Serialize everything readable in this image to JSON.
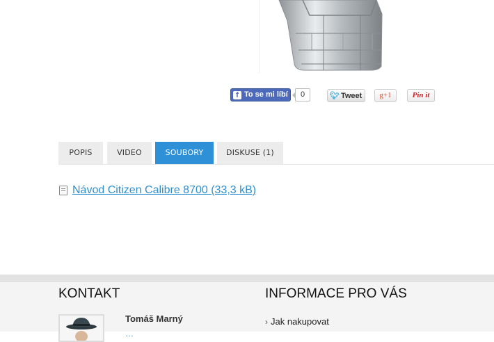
{
  "product": {
    "image_alt": "watch-bracelet"
  },
  "social": {
    "fb_like_label": "To se mi líbí",
    "fb_count": "0",
    "tweet_label": "Tweet",
    "gplus_label": "g+1",
    "pinit_label": "Pin it",
    "colors": {
      "facebook": "#4c69ba",
      "twitter": "#2aa9e0",
      "gplus": "#dd4b39",
      "pinterest": "#cb2027"
    }
  },
  "tabs": [
    {
      "label": "POPIS",
      "active": false
    },
    {
      "label": "VIDEO",
      "active": false
    },
    {
      "label": "SOUBORY",
      "active": true
    },
    {
      "label": "DISKUSE (1)",
      "active": false
    }
  ],
  "files": [
    {
      "label": "Návod Citizen Calibre 8700 (33,3 kB)",
      "icon": "document-icon"
    }
  ],
  "footer": {
    "contact_heading": "KONTAKT",
    "contact_name": "Tomáš Marný",
    "contact_email": "…",
    "info_heading": "INFORMACE PRO VÁS",
    "info_links": [
      "Jak nakupovat"
    ]
  },
  "theme": {
    "accent": "#2e91d7",
    "link": "#2e8fcf"
  }
}
